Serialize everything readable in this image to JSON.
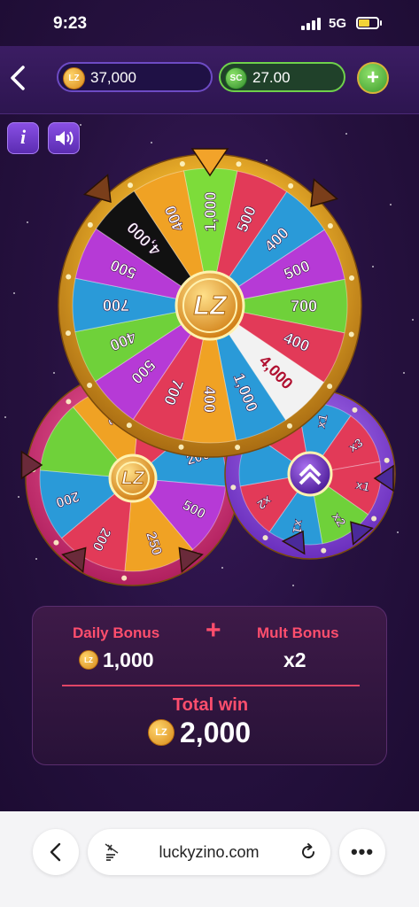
{
  "status_bar": {
    "time": "9:23",
    "network": "5G"
  },
  "top_bar": {
    "lz_balance": "37,000",
    "sc_balance": "27.00",
    "lz_coin_label": "LZ",
    "sc_coin_label": "SC",
    "add_label": "+"
  },
  "buttons": {
    "info_label": "i"
  },
  "main_wheel": {
    "segments": [
      {
        "label": "1,000",
        "color": "#7ddc3a"
      },
      {
        "label": "500",
        "color": "#e23a58"
      },
      {
        "label": "400",
        "color": "#2a9ad8"
      },
      {
        "label": "500",
        "color": "#b63ad6"
      },
      {
        "label": "700",
        "color": "#6fd13a"
      },
      {
        "label": "400",
        "color": "#e23a58"
      },
      {
        "label": "4,000",
        "color": "#f2f2f2"
      },
      {
        "label": "1,000",
        "color": "#2a9ad8"
      },
      {
        "label": "400",
        "color": "#f0a224"
      },
      {
        "label": "700",
        "color": "#e23a58"
      },
      {
        "label": "500",
        "color": "#b63ad6"
      },
      {
        "label": "400",
        "color": "#6fd13a"
      },
      {
        "label": "700",
        "color": "#2a9ad8"
      },
      {
        "label": "500",
        "color": "#b63ad6"
      },
      {
        "label": "4,000",
        "color": "#111111"
      },
      {
        "label": "400",
        "color": "#f0a224"
      }
    ],
    "hub_label": "LZ"
  },
  "left_wheel": {
    "segments": [
      {
        "label": "350",
        "color": "#f0a224"
      },
      {
        "label": "250",
        "color": "#e23a58"
      },
      {
        "label": "200",
        "color": "#2a9ad8"
      },
      {
        "label": "500",
        "color": "#b63ad6"
      },
      {
        "label": "250",
        "color": "#f0a224"
      },
      {
        "label": "200",
        "color": "#e23a58"
      },
      {
        "label": "200",
        "color": "#2a9ad8"
      },
      {
        "label": "",
        "color": "#6fd13a"
      }
    ],
    "hub_label": "LZ"
  },
  "right_wheel": {
    "segments": [
      {
        "label": "x1",
        "color": "#2a9ad8"
      },
      {
        "label": "x3",
        "color": "#e23a58"
      },
      {
        "label": "x1",
        "color": "#e23a58"
      },
      {
        "label": "x2",
        "color": "#6fd13a"
      },
      {
        "label": "x1",
        "color": "#2a9ad8"
      },
      {
        "label": "x2",
        "color": "#e23a58"
      },
      {
        "label": "",
        "color": "#2a9ad8"
      },
      {
        "label": "",
        "color": "#e23a58"
      }
    ]
  },
  "bonus": {
    "daily_label": "Daily Bonus",
    "plus": "+",
    "mult_label": "Mult Bonus",
    "daily_value": "1,000",
    "mult_value": "x2",
    "total_label": "Total win",
    "total_value": "2,000",
    "coin_label": "LZ"
  },
  "browser": {
    "url": "luckyzino.com",
    "more": "•••"
  },
  "colors": {
    "accent_red": "#ff4e6d",
    "gold": "#e9b23a",
    "background": "#26113f"
  }
}
